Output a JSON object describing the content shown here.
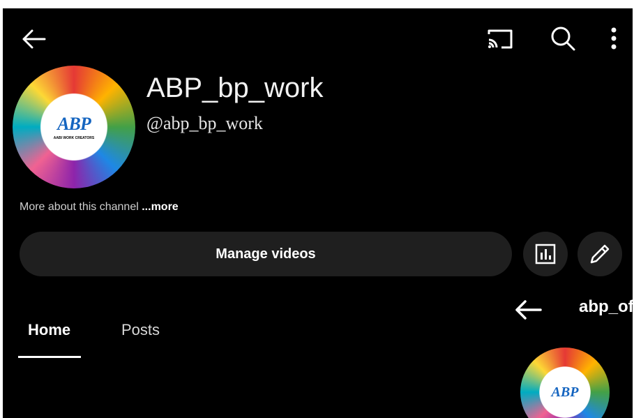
{
  "header": {
    "icons": [
      "back-arrow-icon",
      "cast-icon",
      "search-icon",
      "more-vert-icon"
    ]
  },
  "channel": {
    "name": "ABP_bp_work",
    "handle": "@abp_bp_work",
    "avatar_logo": "ABP",
    "avatar_subtitle": "AABI WORK CREATORS",
    "about_text": "More about this channel",
    "about_more": "...more"
  },
  "actions": {
    "manage_videos": "Manage videos",
    "icons": [
      "analytics-icon",
      "edit-icon"
    ]
  },
  "tabs": [
    {
      "label": "Home",
      "selected": true
    },
    {
      "label": "Posts",
      "selected": false
    }
  ],
  "overlay": {
    "title": "abp_of",
    "avatar_logo": "ABP"
  },
  "colors": {
    "background": "#000000",
    "button": "#1f1f1f",
    "text": "#ffffff",
    "logo_blue": "#1565c0"
  }
}
